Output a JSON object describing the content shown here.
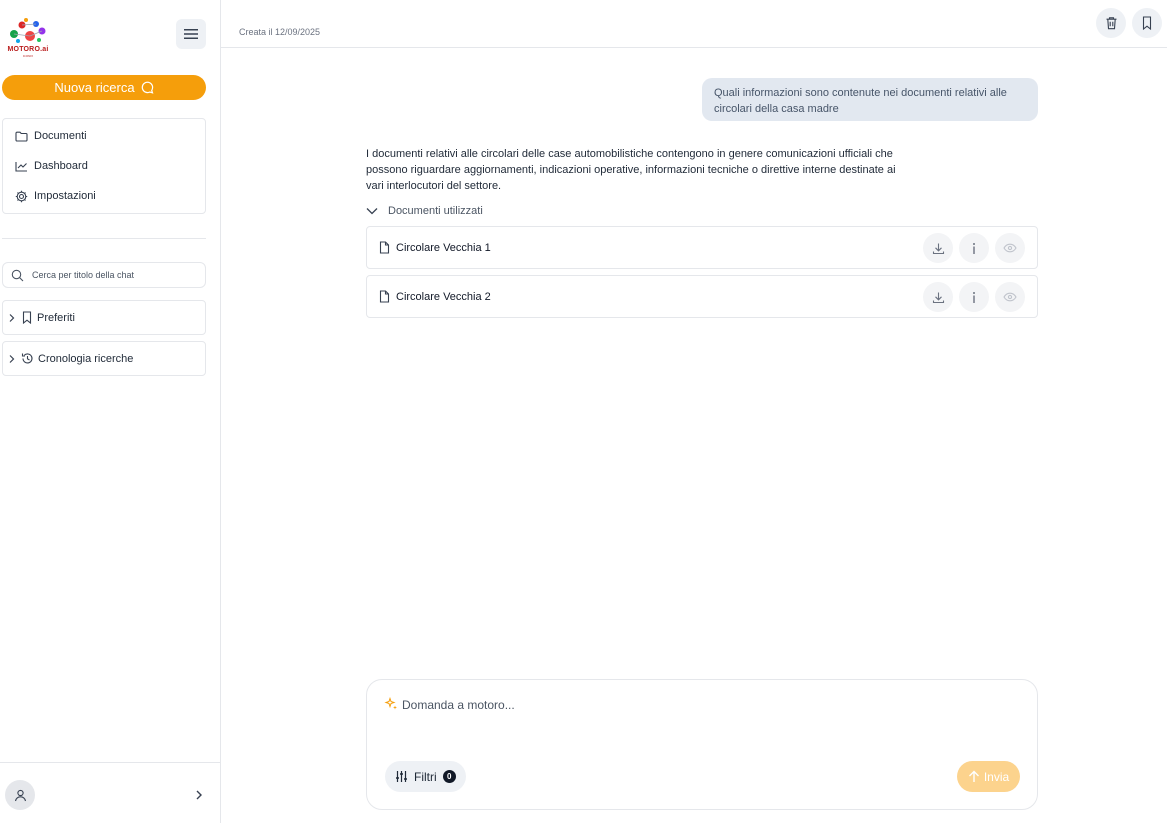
{
  "brand": {
    "name": "MOTORO.ai",
    "sub": "ICONIX",
    "accent": "#f59e0b"
  },
  "sidebar": {
    "new_search_label": "Nuova ricerca",
    "nav": [
      {
        "label": "Documenti",
        "icon": "folder-icon"
      },
      {
        "label": "Dashboard",
        "icon": "chart-line-icon"
      },
      {
        "label": "Impostazioni",
        "icon": "gear-icon"
      }
    ],
    "search_placeholder": "Cerca per titolo della chat",
    "groups": [
      {
        "label": "Preferiti",
        "icon": "bookmark-icon"
      },
      {
        "label": "Cronologia ricerche",
        "icon": "history-icon"
      }
    ]
  },
  "header": {
    "created": "Creata il 12/09/2025"
  },
  "chat": {
    "user_message": "Quali informazioni sono contenute nei documenti relativi alle circolari della casa madre",
    "answer": "I documenti relativi alle circolari delle case automobilistiche contengono in genere comunicazioni ufficiali che possono riguardare aggiornamenti, indicazioni operative, informazioni tecniche o direttive interne destinate ai vari interlocutori del settore.",
    "docs_label": "Documenti utilizzati",
    "documents": [
      {
        "name": "Circolare Vecchia 1"
      },
      {
        "name": "Circolare Vecchia 2"
      }
    ]
  },
  "composer": {
    "placeholder": "Domanda a motoro...",
    "filters_label": "Filtri",
    "filters_count": "0",
    "send_label": "Invia"
  }
}
